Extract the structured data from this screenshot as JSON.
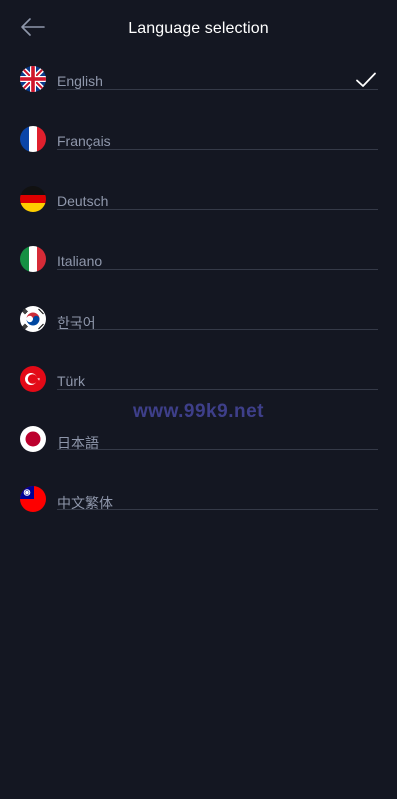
{
  "header": {
    "title": "Language selection",
    "back_icon": "arrow-left-icon"
  },
  "languages": [
    {
      "label": "English",
      "flag": "uk-flag-icon",
      "selected": true
    },
    {
      "label": "Français",
      "flag": "france-flag-icon",
      "selected": false
    },
    {
      "label": "Deutsch",
      "flag": "germany-flag-icon",
      "selected": false
    },
    {
      "label": "Italiano",
      "flag": "italy-flag-icon",
      "selected": false
    },
    {
      "label": "한국어",
      "flag": "korea-flag-icon",
      "selected": false
    },
    {
      "label": "Türk",
      "flag": "turkey-flag-icon",
      "selected": false
    },
    {
      "label": "日本語",
      "flag": "japan-flag-icon",
      "selected": false
    },
    {
      "label": "中文繁体",
      "flag": "taiwan-flag-icon",
      "selected": false
    }
  ],
  "selected_icon": "checkmark-icon",
  "watermark": "www.99k9.net",
  "colors": {
    "background": "#141722",
    "title": "#ffffff",
    "label": "#8f97ab",
    "divider": "#353a48",
    "watermark": "#3e3f8a"
  }
}
